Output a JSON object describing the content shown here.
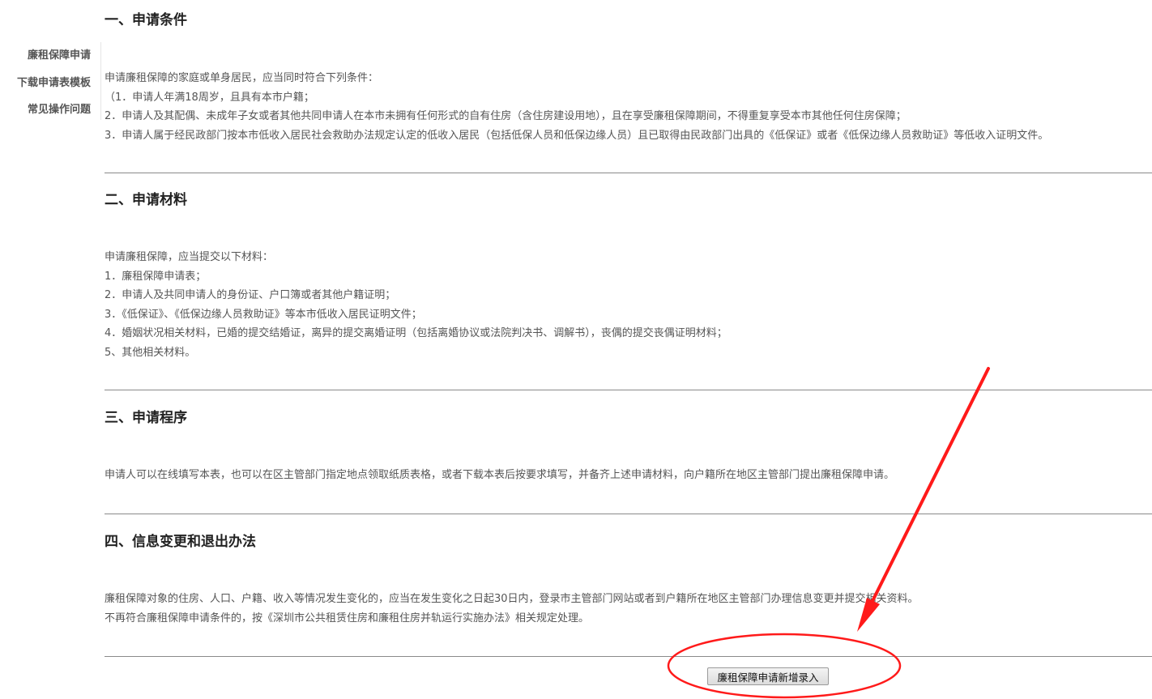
{
  "sidebar": {
    "items": [
      {
        "label": "廉租保障申请"
      },
      {
        "label": "下载申请表模板"
      },
      {
        "label": "常见操作问题"
      }
    ]
  },
  "sections": [
    {
      "heading": "一、申请条件",
      "lines": [
        "申请廉租保障的家庭或单身居民，应当同时符合下列条件：",
        "（1．申请人年满18周岁，且具有本市户籍；",
        "2．申请人及其配偶、未成年子女或者其他共同申请人在本市未拥有任何形式的自有住房（含住房建设用地），且在享受廉租保障期间，不得重复享受本市其他任何住房保障；",
        "3．申请人属于经民政部门按本市低收入居民社会救助办法规定认定的低收入居民（包括低保人员和低保边缘人员）且已取得由民政部门出具的《低保证》或者《低保边缘人员救助证》等低收入证明文件。"
      ]
    },
    {
      "heading": "二、申请材料",
      "lines": [
        "申请廉租保障，应当提交以下材料：",
        "1．廉租保障申请表；",
        "2．申请人及共同申请人的身份证、户口簿或者其他户籍证明；",
        "3．《低保证》、《低保边缘人员救助证》等本市低收入居民证明文件；",
        "4．婚姻状况相关材料，已婚的提交结婚证，离异的提交离婚证明（包括离婚协议或法院判决书、调解书），丧偶的提交丧偶证明材料；",
        "5、其他相关材料。"
      ]
    },
    {
      "heading": "三、申请程序",
      "lines": [
        "申请人可以在线填写本表，也可以在区主管部门指定地点领取纸质表格，或者下载本表后按要求填写，并备齐上述申请材料，向户籍所在地区主管部门提出廉租保障申请。"
      ]
    },
    {
      "heading": "四、信息变更和退出办法",
      "lines": [
        "廉租保障对象的住房、人口、户籍、收入等情况发生变化的，应当在发生变化之日起30日内，登录市主管部门网站或者到户籍所在地区主管部门办理信息变更并提交相关资料。",
        "不再符合廉租保障申请条件的，按《深圳市公共租赁住房和廉租住房并轨运行实施办法》相关规定处理。"
      ]
    }
  ],
  "submit_button": {
    "label": "廉租保障申请新增录入"
  },
  "annotation": {
    "color": "#ff1a1a"
  }
}
